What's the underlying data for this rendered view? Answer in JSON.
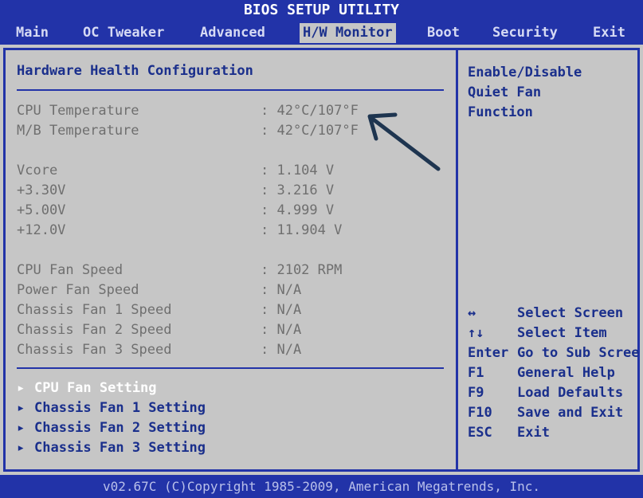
{
  "app": {
    "title": "BIOS SETUP UTILITY"
  },
  "menu": [
    {
      "label": "Main"
    },
    {
      "label": "OC Tweaker"
    },
    {
      "label": "Advanced"
    },
    {
      "label": "H/W Monitor"
    },
    {
      "label": "Boot"
    },
    {
      "label": "Security"
    },
    {
      "label": "Exit"
    }
  ],
  "main": {
    "section_title": "Hardware Health Configuration",
    "temps": [
      {
        "label": "CPU Temperature",
        "value": ": 42°C/107°F"
      },
      {
        "label": "M/B Temperature",
        "value": ": 42°C/107°F"
      }
    ],
    "voltages": [
      {
        "label": "Vcore",
        "value": ": 1.104 V"
      },
      {
        "label": "+3.30V",
        "value": ": 3.216 V"
      },
      {
        "label": "+5.00V",
        "value": ": 4.999 V"
      },
      {
        "label": "+12.0V",
        "value": ": 11.904 V"
      }
    ],
    "fans": [
      {
        "label": "CPU Fan Speed",
        "value": ": 2102 RPM"
      },
      {
        "label": "Power Fan Speed",
        "value": ": N/A"
      },
      {
        "label": "Chassis Fan 1 Speed",
        "value": ": N/A"
      },
      {
        "label": "Chassis Fan 2 Speed",
        "value": ": N/A"
      },
      {
        "label": "Chassis Fan 3 Speed",
        "value": ": N/A"
      }
    ],
    "submenus": [
      {
        "label": "CPU Fan Setting"
      },
      {
        "label": "Chassis Fan 1 Setting"
      },
      {
        "label": "Chassis Fan 2 Setting"
      },
      {
        "label": "Chassis Fan 3 Setting"
      }
    ]
  },
  "help": {
    "lines": [
      "Enable/Disable",
      "Quiet Fan",
      "Function"
    ]
  },
  "keys": [
    {
      "key": "↔",
      "desc": "Select Screen"
    },
    {
      "key": "↑↓",
      "desc": "Select Item"
    },
    {
      "key": "Enter",
      "desc": "Go to Sub Scree"
    },
    {
      "key": "F1",
      "desc": "General Help"
    },
    {
      "key": "F9",
      "desc": "Load Defaults"
    },
    {
      "key": "F10",
      "desc": "Save and Exit"
    },
    {
      "key": "ESC",
      "desc": "Exit"
    }
  ],
  "footer": {
    "text": "v02.67C (C)Copyright 1985-2009, American Megatrends, Inc."
  },
  "colors": {
    "bios_blue": "#2233a8",
    "panel_grey": "#c6c6c6",
    "text_blue": "#1a2f8c",
    "disabled_grey": "#6f6f6f",
    "selected_white": "#ffffff"
  }
}
